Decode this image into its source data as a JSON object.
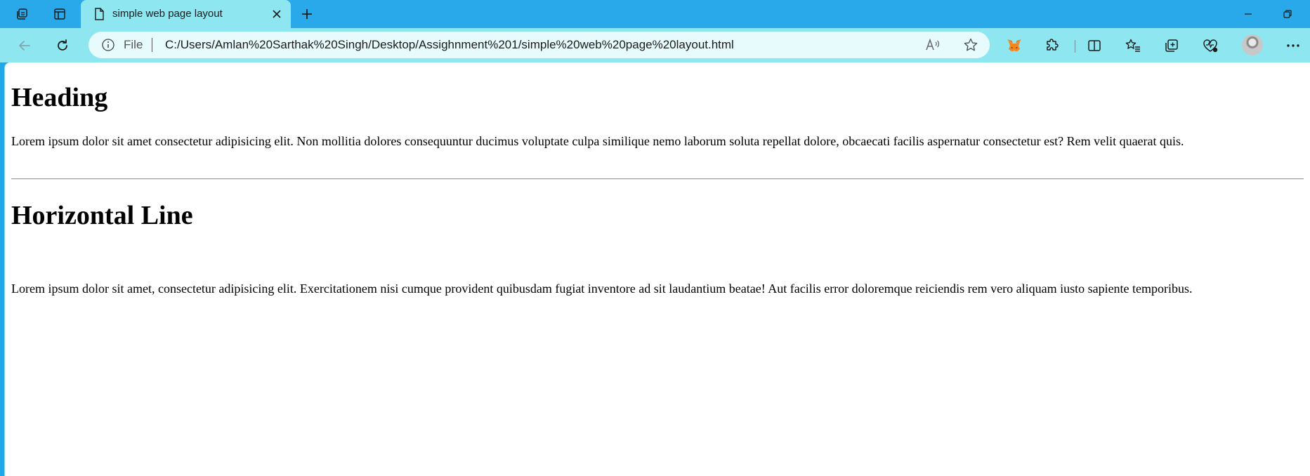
{
  "tabstrip": {
    "workspaces_icon": "workspaces-icon",
    "tab_actions_icon": "tab-actions-icon",
    "active_tab": {
      "title": "simple web page layout",
      "favicon": "page-icon",
      "close_icon": "close-icon"
    },
    "new_tab_icon": "plus-icon",
    "window_controls": [
      "minimize-icon",
      "restore-icon"
    ]
  },
  "toolbar": {
    "back_icon": "back-arrow-icon",
    "refresh_icon": "refresh-icon",
    "omnibox": {
      "site_info_icon": "info-icon",
      "scheme_label": "File",
      "url": "C:/Users/Amlan%20Sarthak%20Singh/Desktop/Assighnment%201/simple%20web%20page%20layout.html",
      "read_aloud_icon": "read-aloud-icon",
      "favorite_icon": "star-icon"
    },
    "extensions": [
      "metamask-fox-icon",
      "puzzle-extensions-icon"
    ],
    "right_tools": [
      "split-screen-icon",
      "favorites-icon",
      "collections-icon",
      "browser-essentials-icon"
    ],
    "profile_avatar": "avatar",
    "menu_icon": "more-icon"
  },
  "page": {
    "heading": "Heading",
    "paragraph1": "Lorem ipsum dolor sit amet consectetur adipisicing elit. Non mollitia dolores consequuntur ducimus voluptate culpa similique nemo laborum soluta repellat dolore, obcaecati facilis aspernatur consectetur est? Rem velit quaerat quis.",
    "heading2": "Horizontal Line",
    "paragraph2": "Lorem ipsum dolor sit amet, consectetur adipisicing elit. Exercitationem nisi cumque provident quibusdam fugiat inventore ad sit laudantium beatae! Aut facilis error doloremque reiciendis rem vero aliquam iusto sapiente temporibus."
  },
  "colors": {
    "tabstrip_bg": "#2aa9ea",
    "toolbar_bg": "#8ee7f0",
    "omnibox_bg": "#e7fbfc",
    "page_bg": "#ffffff"
  }
}
